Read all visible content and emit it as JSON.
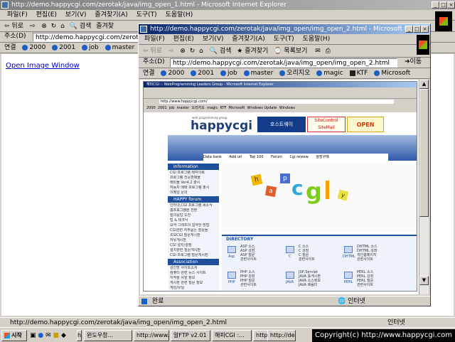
{
  "back_window": {
    "title": "http://demo.happycgi.com/zerotak/java/img_open_1.html - Microsoft Internet Explorer",
    "menu": [
      "파일(F)",
      "편집(E)",
      "보기(V)",
      "즐겨찾기(A)",
      "도구(T)",
      "도움말(H)"
    ],
    "toolbar": {
      "back": "뒤로",
      "search": "검색",
      "favorites": "즐겨찾"
    },
    "address_label": "주소(D)",
    "address_value": "http://demo.happycgi.com/zerotak/java/",
    "links_label": "연결",
    "links": [
      "2000",
      "2001",
      "job",
      "master",
      "오리"
    ],
    "page_link": "Open Image Window",
    "status": "http://demo.happycgi.com/zerotak/java/img_open/img_open_2.html",
    "status_zone": "인터넷"
  },
  "front_window": {
    "title": "http://demo.happycgi.com/zerotak/java/img_open/img_open_2.html - Microsoft Internet Explorer",
    "menu": [
      "파일(F)",
      "편집(E)",
      "보기(V)",
      "즐겨찾기(A)",
      "도구(T)",
      "도움말(H)"
    ],
    "toolbar": {
      "back": "뒤로",
      "search": "검색",
      "favorites": "즐겨찾기",
      "history": "목록보기"
    },
    "address_label": "주소(D)",
    "address_value": "http://demo.happycgi.com/zerotak/java/img_open/img_open_2.html",
    "go_label": "이동",
    "links_label": "연결",
    "links": [
      "2000",
      "2001",
      "job",
      "master",
      "오리지오",
      "magic",
      "KTF",
      "Microsoft"
    ],
    "status": "완료",
    "status_zone": "인터넷"
  },
  "inner_screenshot": {
    "title": "해피CGI :: WebProgramming Leaders Group - Microsoft Internet Explorer",
    "address": "http://www.happycgi.com/",
    "links": [
      "2000",
      "2001",
      "job",
      "master",
      "오리지오",
      "magic",
      "KTF",
      "Microsoft",
      "Windows Update",
      "Windows"
    ],
    "logo_small": "web programming group",
    "logo": "happycgi",
    "banner1": "호스트웨이",
    "banner2_top": "SiteControl",
    "banner2_bottom": "SiteMail",
    "banner3": "OPEN",
    "nav": [
      "Data bank",
      "Add url",
      "Top 100",
      "Forum",
      "Cgi review",
      "광장구매"
    ],
    "sections": {
      "information": "Information",
      "forum": "HAPPY forum",
      "association": "Association",
      "directory": "DIRECTORY"
    },
    "info_items": [
      "CGI 프로그램 제작의뢰",
      "프로그램 전문판매몰",
      "해피몰 Ver4.2 출시",
      "자동차 매매 프로그램 출시",
      "이메일 문의"
    ],
    "forum_items": [
      "인터넷,CGI 프로그램 세소식",
      "홈프로그램분 전환",
      "질의응답 오전",
      "팁 & 테크닉",
      "요약 그래프의 집약한 방법",
      "CGI관련 자주묻는 질문들",
      "초보CGI 질문게시판",
      "자유게시판",
      "CGI 설치/설정",
      "설치관련 질문게시판",
      "CGI 프로그램 질문게시판"
    ],
    "assoc_items": [
      "성인방 사이트소개",
      "컴퓨터 관련 뉴스 사이트",
      "지적을 유발 정보",
      "게시판 관련 질문 정보",
      "게임/유틸"
    ],
    "dir_row1": [
      {
        "cap": "Asp",
        "items": [
          "ASP 소스",
          "ASP 강좌",
          "ASP 질문",
          "관련사이트"
        ]
      },
      {
        "cap": "C",
        "items": [
          "C 소스",
          "C 강좌",
          "C 질문",
          "관련사이트"
        ]
      },
      {
        "cap": "DHTML",
        "items": [
          "DHTML 소스",
          "DHTML 강좌",
          "개인홈페이지",
          "관련사이트"
        ]
      }
    ],
    "dir_row2": [
      {
        "cap": "PHP",
        "items": [
          "PHP 소스",
          "PHP 강좌",
          "PHP 질문",
          "관련사이트"
        ]
      },
      {
        "cap": "JAVA",
        "items": [
          "JSP,Servlet",
          "JAVA 홀게시판",
          "JAVA 소스정보",
          "JAVA 배움터"
        ]
      },
      {
        "cap": "PERL",
        "items": [
          "PERL 소스",
          "PERL 강좌",
          "PERL 질문",
          "관련사이트"
        ]
      }
    ]
  },
  "taskbar": {
    "start": "시작",
    "tasks": [
      "http://demo...",
      "윈도우창...",
      "http://www...",
      "알FTP v2.01",
      "해피CGI :...",
      "http://dem...",
      "http://de..."
    ],
    "tray_text": "Copyright(c) http://www.happycgi.com"
  },
  "colors": {
    "title_active": "#0a246a",
    "title_inactive": "#808080",
    "chrome": "#d4d0c8",
    "link": "#0000cc",
    "site_blue": "#1f4f9a"
  }
}
